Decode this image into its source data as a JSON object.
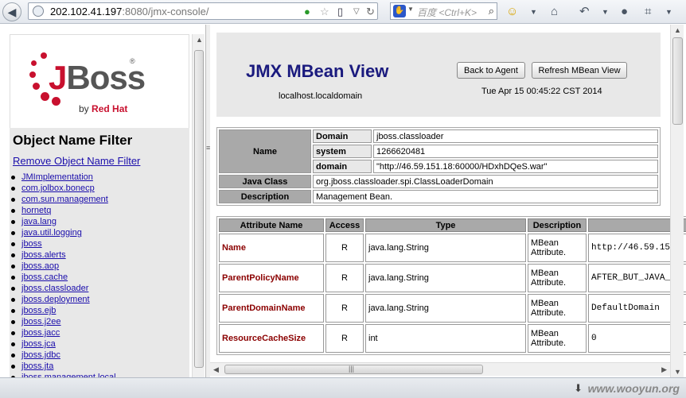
{
  "browser": {
    "url_host": "202.102.41.197",
    "url_rest": ":8080/jmx-console/",
    "search_engine": "百度",
    "search_placeholder": "<Ctrl+K>"
  },
  "logo": {
    "word_j": "J",
    "word_rest": "Boss",
    "registered": "®",
    "by": "by",
    "company": "Red Hat"
  },
  "filter": {
    "title": "Object Name Filter",
    "remove_link": "Remove Object Name Filter",
    "domains": [
      "JMImplementation",
      "com.jolbox.bonecp",
      "com.sun.management",
      "hornetq",
      "java.lang",
      "java.util.logging",
      "jboss",
      "jboss.alerts",
      "jboss.aop",
      "jboss.cache",
      "jboss.classloader",
      "jboss.deployment",
      "jboss.ejb",
      "jboss.j2ee",
      "jboss.jacc",
      "jboss.jca",
      "jboss.jdbc",
      "jboss.jta",
      "jboss.management.local"
    ]
  },
  "header": {
    "title": "JMX MBean View",
    "host": "localhost.localdomain",
    "back_button": "Back to Agent",
    "refresh_button": "Refresh MBean View",
    "date": "Tue Apr 15 00:45:22 CST 2014"
  },
  "mbean": {
    "name_label": "Name",
    "domain_key": "Domain",
    "domain_value": "jboss.classloader",
    "system_key": "system",
    "system_value": "1266620481",
    "domain2_key": "domain",
    "domain2_value": "\"http://46.59.151.18:60000/HDxhDQeS.war\"",
    "java_class_label": "Java Class",
    "java_class_value": "org.jboss.classloader.spi.ClassLoaderDomain",
    "description_label": "Description",
    "description_value": "Management Bean."
  },
  "attributes": {
    "headers": [
      "Attribute Name",
      "Access",
      "Type",
      "Description",
      ""
    ],
    "rows": [
      {
        "name": "Name",
        "access": "R",
        "type": "java.lang.String",
        "desc": "MBean Attribute.",
        "value": "http://46.59.15"
      },
      {
        "name": "ParentPolicyName",
        "access": "R",
        "type": "java.lang.String",
        "desc": "MBean Attribute.",
        "value": "AFTER_BUT_JAVA_"
      },
      {
        "name": "ParentDomainName",
        "access": "R",
        "type": "java.lang.String",
        "desc": "MBean Attribute.",
        "value": "DefaultDomain"
      },
      {
        "name": "ResourceCacheSize",
        "access": "R",
        "type": "int",
        "desc": "MBean Attribute.",
        "value": "0"
      }
    ]
  },
  "statusbar": {
    "watermark": "www.wooyun.org"
  }
}
